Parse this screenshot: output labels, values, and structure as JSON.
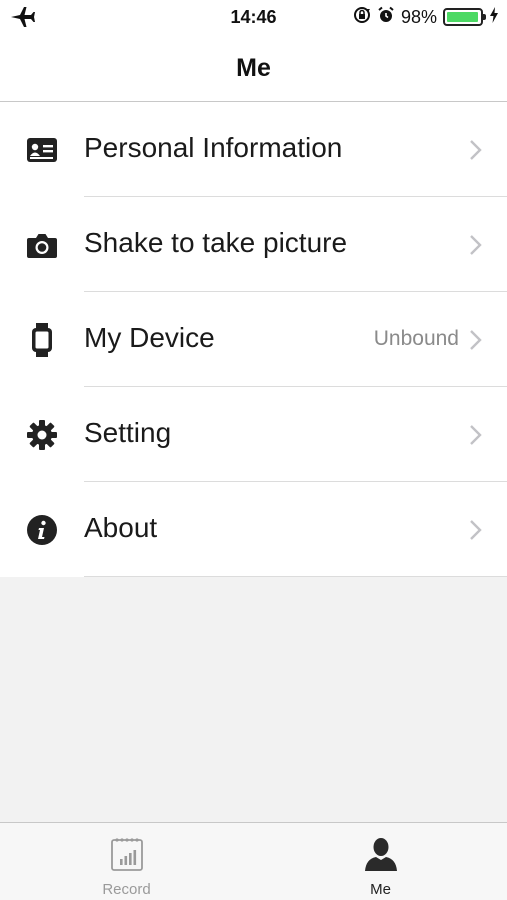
{
  "status_bar": {
    "time": "14:46",
    "battery_percent": "98%",
    "battery_level": 0.98,
    "icons": [
      "airplane-icon",
      "rotation-lock-icon",
      "alarm-icon",
      "battery-icon",
      "charging-icon"
    ]
  },
  "nav": {
    "title": "Me"
  },
  "menu": {
    "items": [
      {
        "label": "Personal Information",
        "icon": "id-card-icon",
        "value": ""
      },
      {
        "label": "Shake to take picture",
        "icon": "camera-icon",
        "value": ""
      },
      {
        "label": "My Device",
        "icon": "watch-icon",
        "value": "Unbound"
      },
      {
        "label": "Setting",
        "icon": "gear-icon",
        "value": ""
      },
      {
        "label": "About",
        "icon": "info-icon",
        "value": ""
      }
    ]
  },
  "tab_bar": {
    "tabs": [
      {
        "label": "Record",
        "icon": "record-calendar-icon",
        "selected": false
      },
      {
        "label": "Me",
        "icon": "person-icon",
        "selected": true
      }
    ]
  },
  "colors": {
    "battery_fill": "#4cd964",
    "background": "#f2f2f2",
    "icon_dark": "#222222"
  }
}
